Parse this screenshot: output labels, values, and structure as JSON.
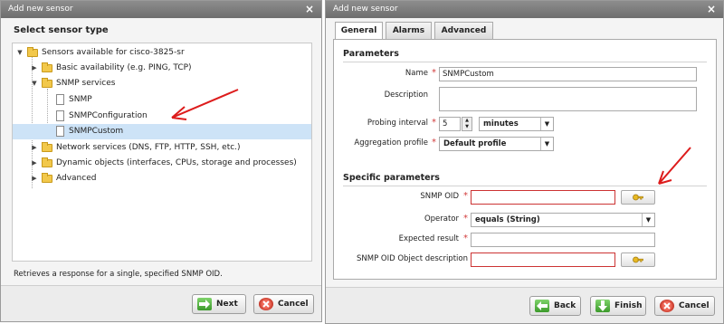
{
  "left_dialog": {
    "title": "Add new sensor",
    "section_title": "Select sensor type",
    "tree": {
      "root": "Sensors available for cisco-3825-sr",
      "items": [
        {
          "label": "Basic availability (e.g. PING, TCP)"
        },
        {
          "label": "SNMP services"
        },
        {
          "label": "SNMP"
        },
        {
          "label": "SNMPConfiguration"
        },
        {
          "label": "SNMPCustom"
        },
        {
          "label": "Network services (DNS, FTP, HTTP, SSH, etc.)"
        },
        {
          "label": "Dynamic objects (interfaces, CPUs, storage and processes)"
        },
        {
          "label": "Advanced"
        }
      ]
    },
    "description": "Retrieves a response for a single, specified SNMP OID.",
    "buttons": {
      "next": "Next",
      "cancel": "Cancel"
    }
  },
  "right_dialog": {
    "title": "Add new sensor",
    "tabs": [
      {
        "label": "General"
      },
      {
        "label": "Alarms"
      },
      {
        "label": "Advanced"
      }
    ],
    "parameters": {
      "title": "Parameters",
      "name_label": "Name",
      "name_value": "SNMPCustom",
      "description_label": "Description",
      "description_value": "",
      "probing_label": "Probing interval",
      "probing_value": "5",
      "probing_unit": "minutes",
      "aggregation_label": "Aggregation profile",
      "aggregation_value": "Default profile"
    },
    "specific": {
      "title": "Specific parameters",
      "oid_label": "SNMP OID",
      "oid_value": "",
      "operator_label": "Operator",
      "operator_value": "equals (String)",
      "expected_label": "Expected result",
      "expected_value": "",
      "oid_desc_label": "SNMP OID Object description",
      "oid_desc_value": ""
    },
    "buttons": {
      "back": "Back",
      "finish": "Finish",
      "cancel": "Cancel"
    }
  },
  "colors": {
    "selection": "#cde3f7",
    "annotation_arrow": "#dd1c1c",
    "required": "#d23c3c"
  }
}
